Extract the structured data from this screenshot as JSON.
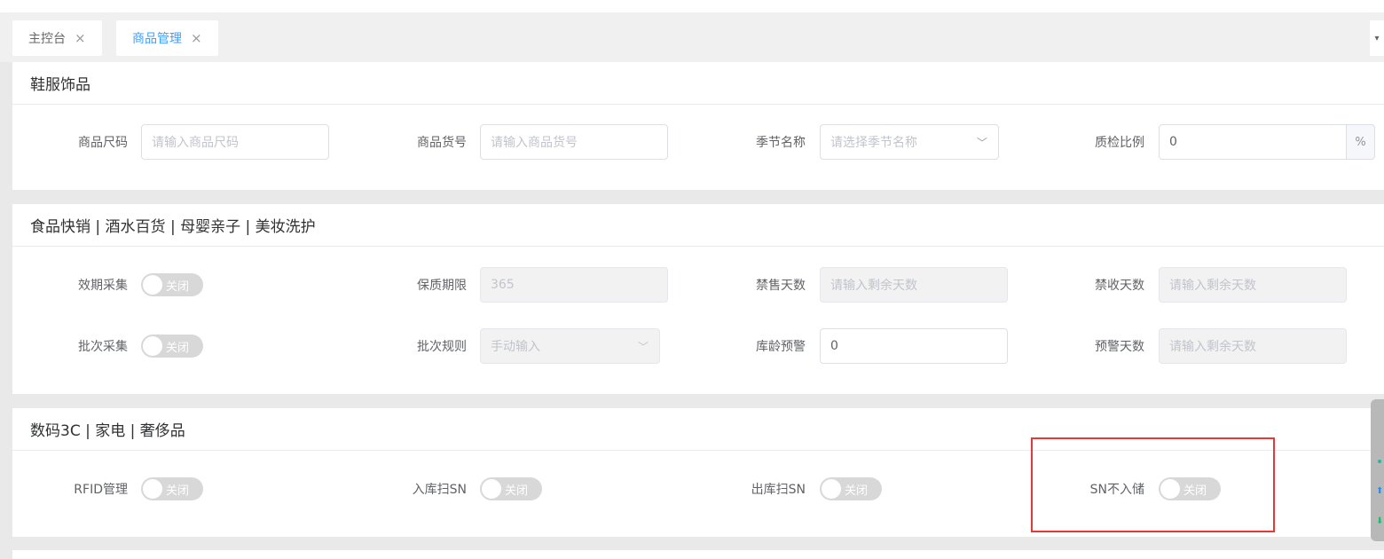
{
  "tabs": [
    {
      "label": "主控台",
      "close": "×"
    },
    {
      "label": "商品管理",
      "close": "×"
    }
  ],
  "tab_menu_icon": "▾",
  "sections": {
    "apparel": {
      "title": "鞋服饰品",
      "fields": {
        "size_label": "商品尺码",
        "size_placeholder": "请输入商品尺码",
        "itemno_label": "商品货号",
        "itemno_placeholder": "请输入商品货号",
        "season_label": "季节名称",
        "season_placeholder": "请选择季节名称",
        "qc_label": "质检比例",
        "qc_value": "0",
        "qc_unit": "%"
      }
    },
    "food": {
      "title": "食品快销 | 酒水百货 | 母婴亲子 | 美妆洗护",
      "fields": {
        "expiry_label": "效期采集",
        "expiry_switch": "关闭",
        "shelf_label": "保质期限",
        "shelf_value": "365",
        "nosale_label": "禁售天数",
        "nosale_placeholder": "请输入剩余天数",
        "noreceive_label": "禁收天数",
        "noreceive_placeholder": "请输入剩余天数",
        "batch_label": "批次采集",
        "batch_switch": "关闭",
        "batchrule_label": "批次规则",
        "batchrule_value": "手动输入",
        "age_label": "库龄预警",
        "age_value": "0",
        "warn_label": "预警天数",
        "warn_placeholder": "请输入剩余天数"
      }
    },
    "digital": {
      "title": "数码3C | 家电 | 奢侈品",
      "fields": {
        "rfid_label": "RFID管理",
        "rfid_switch": "关闭",
        "in_sn_label": "入库扫SN",
        "in_sn_switch": "关闭",
        "out_sn_label": "出库扫SN",
        "out_sn_switch": "关闭",
        "sn_store_label": "SN不入储",
        "sn_store_switch": "关闭"
      }
    }
  },
  "colors": {
    "accent": "#409eff",
    "highlight": "#e53935",
    "switch_off": "#d8d8d8"
  }
}
